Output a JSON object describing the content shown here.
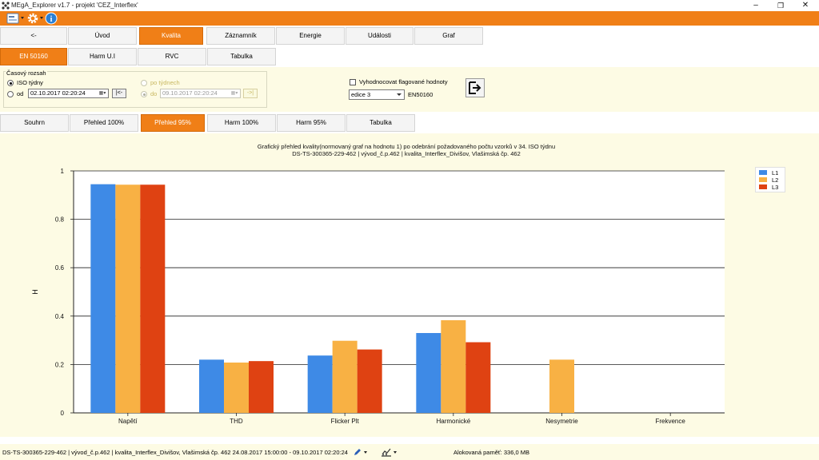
{
  "window": {
    "title": "MEgA_Explorer v1.7 - projekt 'CEZ_Interflex'",
    "minimize_label": "–",
    "maximize_label": "❐",
    "close_label": "✕"
  },
  "toolbar": {
    "icons": [
      "app-menu-icon",
      "gear-icon",
      "info-icon"
    ],
    "info_glyph": "i"
  },
  "main_tabs": [
    {
      "label": "<-",
      "active": false
    },
    {
      "label": "Úvod",
      "active": false
    },
    {
      "label": "Kvalita",
      "active": true
    },
    {
      "label": "Záznamník",
      "active": false
    },
    {
      "label": "Energie",
      "active": false
    },
    {
      "label": "Události",
      "active": false
    },
    {
      "label": "Graf",
      "active": false
    }
  ],
  "sub_tabs": [
    {
      "label": "EN 50160",
      "active": true
    },
    {
      "label": "Harm U.I",
      "active": false
    },
    {
      "label": "RVC",
      "active": false
    },
    {
      "label": "Tabulka",
      "active": false
    }
  ],
  "filter": {
    "group_label": "Časový rozsah",
    "iso_weeks_label": "ISO týdny",
    "from_label": "od",
    "from_value": "02.10.2017 02:20:24",
    "from_nav": "|<-",
    "by_weeks_label": "po týdnech",
    "to_label": "do",
    "to_value": "09.10.2017 02:20:24",
    "to_nav": "->|",
    "flagged_label": "Vyhodnocovat flagované hodnoty",
    "edition_value": "edice 3",
    "standard_label": "EN50160"
  },
  "view_tabs": [
    {
      "label": "Souhrn",
      "active": false
    },
    {
      "label": "Přehled 100%",
      "active": false
    },
    {
      "label": "Přehled 95%",
      "active": true
    },
    {
      "label": "Harm 100%",
      "active": false
    },
    {
      "label": "Harm 95%",
      "active": false
    },
    {
      "label": "Tabulka",
      "active": false
    }
  ],
  "chart_data": {
    "type": "bar",
    "title": "Grafický přehled kvality(normovaný graf na hodnotu 1) po odebrání požadovaného počtu vzorků v 34. ISO týdnu",
    "subtitle": "DS-TS-300365-229-462 | vývod_č.p.462 | kvalita_Interflex_Divišov, Vlašimská čp. 462",
    "xlabel": "",
    "ylabel": "H",
    "ylim": [
      0,
      1
    ],
    "yticks": [
      "0",
      "0.2",
      "0.4",
      "0.6",
      "0.8",
      "1"
    ],
    "grid": true,
    "legend_position": "top-right",
    "categories": [
      "Napětí",
      "THD",
      "Flicker Plt",
      "Harmonické",
      "Nesymetrie",
      "Frekvence"
    ],
    "series": [
      {
        "name": "L1",
        "color": "#3e8ae6",
        "values": [
          0.945,
          0.22,
          0.237,
          0.33,
          null,
          null
        ]
      },
      {
        "name": "L2",
        "color": "#f8b144",
        "values": [
          0.943,
          0.208,
          0.298,
          0.383,
          0.22,
          null
        ]
      },
      {
        "name": "L3",
        "color": "#df4212",
        "values": [
          0.943,
          0.214,
          0.262,
          0.292,
          null,
          null
        ]
      }
    ]
  },
  "status": {
    "path": "DS-TS-300365-229-462 | vývod_č.p.462 | kvalita_Interflex_Divišov, Vlašimská čp. 462  24.08.2017 15:00:00 - 09.10.2017 02:20:24",
    "memory": "Alokovaná paměť: 336,0 MB",
    "icons": [
      "pencil-icon",
      "chart-settings-icon"
    ]
  },
  "colors": {
    "accent": "#f07f17",
    "panel_bg": "#fdfbe4"
  }
}
